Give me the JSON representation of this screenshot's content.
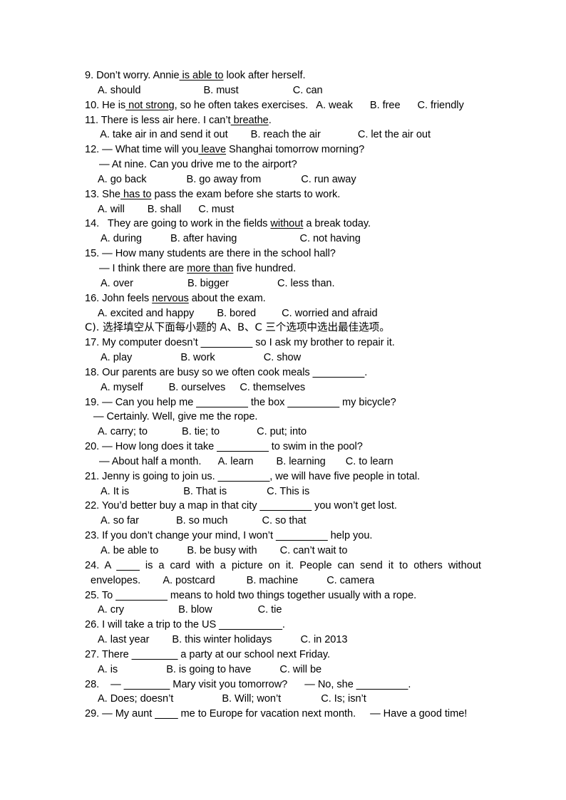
{
  "document": {
    "type": "exam-worksheet",
    "language": "en-zh",
    "page_background": "#ffffff",
    "text_color": "#000000"
  },
  "section_heading": {
    "label": "C). 选择填空从下面每小题的 A、B、C 三个选项中选出最佳选项。"
  },
  "lines": {
    "q9_stem": "9. Don’t worry. Annie is able to look after herself.",
    "q9_stem_pre": "9. Don’t worry. Annie",
    "q9_stem_underline": " is able to",
    "q9_stem_post": " look after herself.",
    "q9_options": "A. should                      B. must                   C. can",
    "q10_pre": "10. He is",
    "q10_underline": " not strong",
    "q10_post": ", so he often takes exercises.   A. weak      B. free      C. friendly",
    "q11_pre": "11. There is less air here. I can’t",
    "q11_underline": " breathe",
    "q11_post": ".",
    "q11_options": " A. take air in and send it out        B. reach the air             C. let the air out",
    "q12_pre": "12. — What time will you",
    "q12_underline": " leave",
    "q12_post": " Shanghai tomorrow morning?",
    "q12_dash2": "— At nine. Can you drive me to the airport?",
    "q12_options": "A. go back              B. go away from              C. run away",
    "q13_pre": "13. She",
    "q13_underline": " has to",
    "q13_post": " pass the exam before she starts to work.",
    "q13_options": "A. will        B. shall      C. must",
    "q14_pre": "14.   They are going to work in the fields ",
    "q14_underline": "without",
    "q14_post": " a break today.",
    "q14_options": "A. during          B. after having                      C. not having",
    "q15_stem": "15. — How many students are there in the school hall?",
    "q15_dash2_pre": "— I think there are ",
    "q15_dash2_underline": "more than",
    "q15_dash2_post": " five hundred.",
    "q15_options": "A. over                   B. bigger                 C. less than.",
    "q16_pre": "16. John feels ",
    "q16_underline": "nervous",
    "q16_post": " about the exam.",
    "q16_options": "A. excited and happy        B. bored         C. worried and afraid",
    "q17_pre": "17. My computer doesn’t ",
    "q17_blank": "_________",
    "q17_post": " so I ask my brother to repair it.",
    "q17_options": "A. play                 B. work                 C. show",
    "q18_pre": "18. Our parents are busy so we often cook meals ",
    "q18_blank": "_________",
    "q18_post": ".",
    "q18_options": "A. myself         B. ourselves     C. themselves",
    "q19_pre": "19. — Can you help me ",
    "q19_blank1": "_________",
    "q19_mid": " the box ",
    "q19_blank2": "_________",
    "q19_post": " my bicycle?",
    "q19_dash2": "— Certainly. Well, give me the rope.",
    "q19_options": "A. carry; to            B. tie; to             C. put; into",
    "q20_pre": "20. — How long does it take ",
    "q20_blank": "_________",
    "q20_post": " to swim in the pool?",
    "q20_dash2": "— About half a month.      A. learn        B. learning       C. to learn",
    "q21_pre": "21. Jenny is going to join us. ",
    "q21_blank": "_________",
    "q21_post": ", we will have five people in total.",
    "q21_options": "A. It is                   B. That is              C. This is",
    "q22_pre": "22. You’d better buy a map in that city ",
    "q22_blank": "_________",
    "q22_post": " you won’t get lost.",
    "q22_options": "A. so far             B. so much            C. so that",
    "q23_pre": "23. If you don’t change your mind, I won’t ",
    "q23_blank": "_________",
    "q23_post": " help you.",
    "q23_options": "A. be able to          B. be busy with        C. can’t wait to",
    "q24_justified_pre": "24. A ",
    "q24_justified_blank": "____",
    "q24_justified_post": " is a card with a picture on it. People can send it to others without",
    "q24_line2": "envelopes.        A. postcard           B. machine          C. camera",
    "q25_pre": "25. To ",
    "q25_blank": "_________",
    "q25_post": " means to hold two things together usually with a rope.",
    "q25_options": "A. cry                   B. blow                C. tie",
    "q26_pre": "26. I will take a trip to the US ",
    "q26_blank": "___________",
    "q26_post": ".",
    "q26_options": "A. last year        B. this winter holidays          C. in 2013",
    "q27_pre": "27. There ",
    "q27_blank": "________",
    "q27_post": " a party at our school next Friday.",
    "q27_options": "A. is                 B. is going to have          C. will be",
    "q28_pre": "28.    — ",
    "q28_blank1": "________",
    "q28_mid": " Mary visit you tomorrow?      — No, she ",
    "q28_blank2": "_________",
    "q28_post": ".",
    "q28_options": "A. Does; doesn’t                 B. Will; won’t              C. Is; isn’t",
    "q29_pre": "29. — My aunt ",
    "q29_blank": "____",
    "q29_post": " me to Europe for vacation next month.     — Have a good time!"
  }
}
